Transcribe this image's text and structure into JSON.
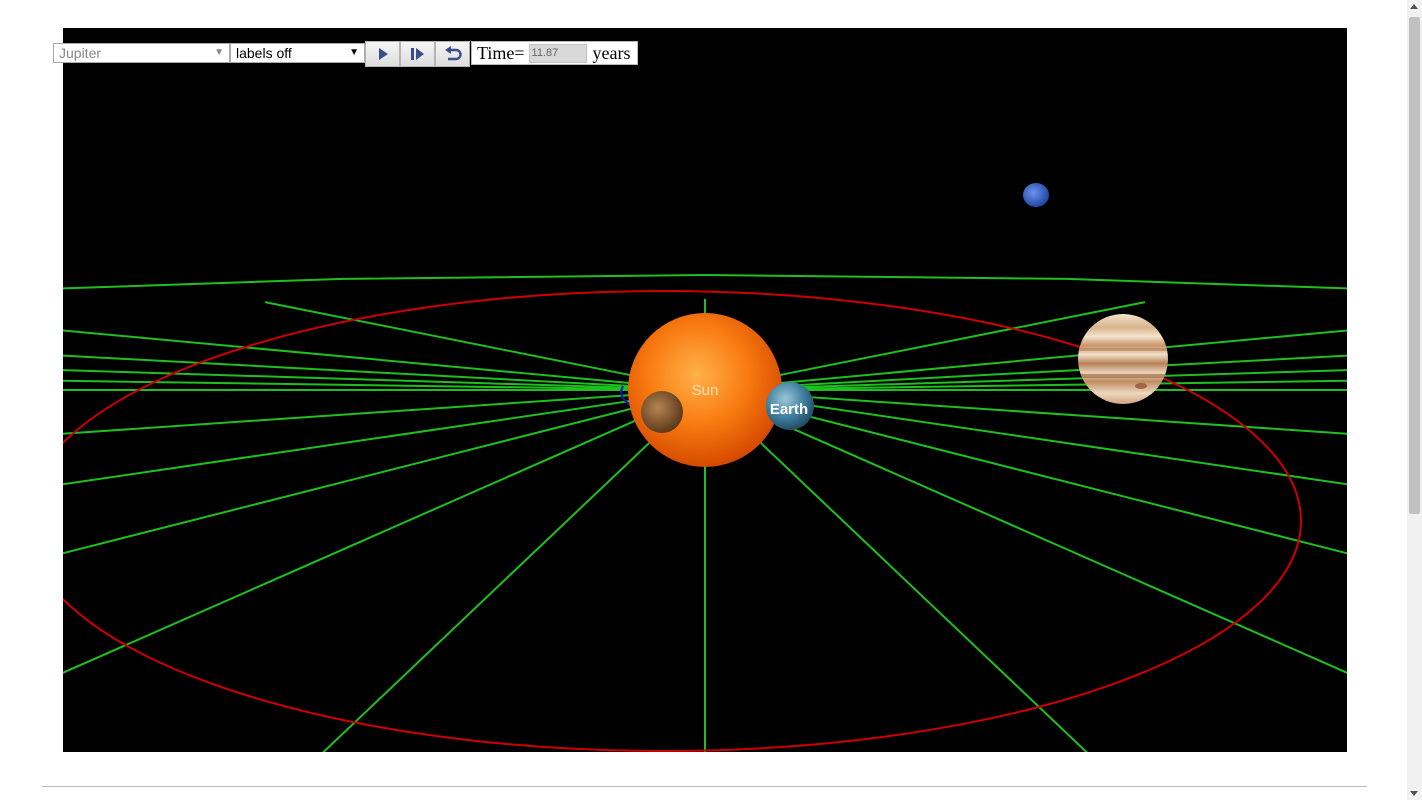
{
  "controls": {
    "planet_select": {
      "value": "Jupiter"
    },
    "labels_select": {
      "value": "labels off"
    },
    "buttons": [
      {
        "name": "play",
        "icon": "play-icon"
      },
      {
        "name": "step",
        "icon": "step-forward-icon"
      },
      {
        "name": "reset",
        "icon": "reset-icon"
      }
    ],
    "time_label": "Time=",
    "time_value": "11.87",
    "time_unit": "years"
  },
  "scene": {
    "bodies": [
      {
        "name": "Sun",
        "label": "Sun",
        "color": "#f97a12"
      },
      {
        "name": "Earth",
        "label": "Earth",
        "color": "#3d7fa8"
      },
      {
        "name": "Jupiter",
        "color": "#d9b48a"
      },
      {
        "name": "Neptune",
        "color": "#3a66c8"
      },
      {
        "name": "Mercury",
        "color": "#8a5a2e"
      }
    ],
    "colors": {
      "grid": "#1fbf1f",
      "jupiter_orbit": "#cc0000",
      "earth_orbit": "#1515c0",
      "background": "#000000"
    }
  }
}
